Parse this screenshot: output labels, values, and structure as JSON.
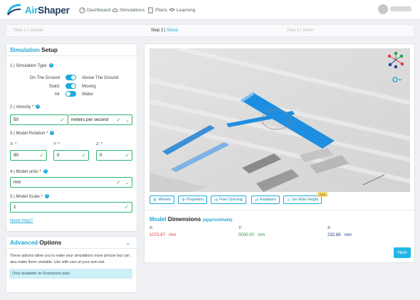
{
  "app": {
    "name_prefix": "Air",
    "name_suffix": "Shaper"
  },
  "nav": [
    {
      "label": "Dashboard",
      "icon": "gauge-icon"
    },
    {
      "label": "Simulations",
      "icon": "cloud-icon"
    },
    {
      "label": "Plans",
      "icon": "document-icon"
    },
    {
      "label": "Learning",
      "icon": "graduation-cap-icon"
    }
  ],
  "steps": [
    {
      "num": "Step 1 | ",
      "label": "Upload",
      "active": false
    },
    {
      "num": "Step 2 | ",
      "label": "Setup",
      "active": true
    },
    {
      "num": "Step 3 | ",
      "label": "Order",
      "active": false
    }
  ],
  "setup": {
    "title_accent": "Simulation",
    "title_rest": " Setup",
    "sim_type_label": "1 | Simulation Type",
    "toggles": [
      {
        "left": "On The Ground",
        "right": "Above The Ground",
        "on": true
      },
      {
        "left": "Static",
        "right": "Moving",
        "on": true
      },
      {
        "left": "Air",
        "right": "Water",
        "on": false
      }
    ],
    "velocity_label": "2 | Velocity *",
    "velocity_value": "50",
    "velocity_unit": "meters per second",
    "rotation_label": "3 | Model Rotation *",
    "rotation": [
      {
        "axis": "X: *",
        "value": "90"
      },
      {
        "axis": "Y: *",
        "value": "0"
      },
      {
        "axis": "Z: *",
        "value": "0"
      }
    ],
    "units_label": "4 | Model units *",
    "units_value": "mm",
    "scale_label": "5 | Model Scale *",
    "scale_value": "1",
    "help_link": "Need Help?"
  },
  "advanced": {
    "title_accent": "Advanced",
    "title_rest": " Options",
    "description": "These options allow you to make your simulations more precise but can also make them unstable. Use with care at your own risk.",
    "notice": "Only available on Enterprise plan."
  },
  "viewer": {
    "tools": [
      {
        "label": "Wheels",
        "icon": "wheel-icon"
      },
      {
        "label": "Propellers",
        "icon": "propeller-icon"
      },
      {
        "label": "Flow Opening",
        "icon": "flow-opening-icon"
      },
      {
        "label": "Radiators",
        "icon": "radiator-icon"
      },
      {
        "label": "Set Ride Height",
        "icon": "ride-height-icon",
        "badge": "Beta"
      }
    ]
  },
  "dimensions": {
    "title_accent": "Model",
    "title_rest": " Dimensions",
    "qualifier": "(approximate)",
    "items": [
      {
        "axis": "X:",
        "value": "1073.67",
        "unit": "mm",
        "color": "#e0344a"
      },
      {
        "axis": "Y:",
        "value": "5000.00",
        "unit": "mm",
        "color": "#2c9a47"
      },
      {
        "axis": "Z:",
        "value": "232.86",
        "unit": "mm",
        "color": "#1d3f8e"
      }
    ]
  },
  "next_label": "Next",
  "colors": {
    "accent": "#22a7d8",
    "valid": "#2bb673",
    "brand_dark": "#1f3b58"
  }
}
